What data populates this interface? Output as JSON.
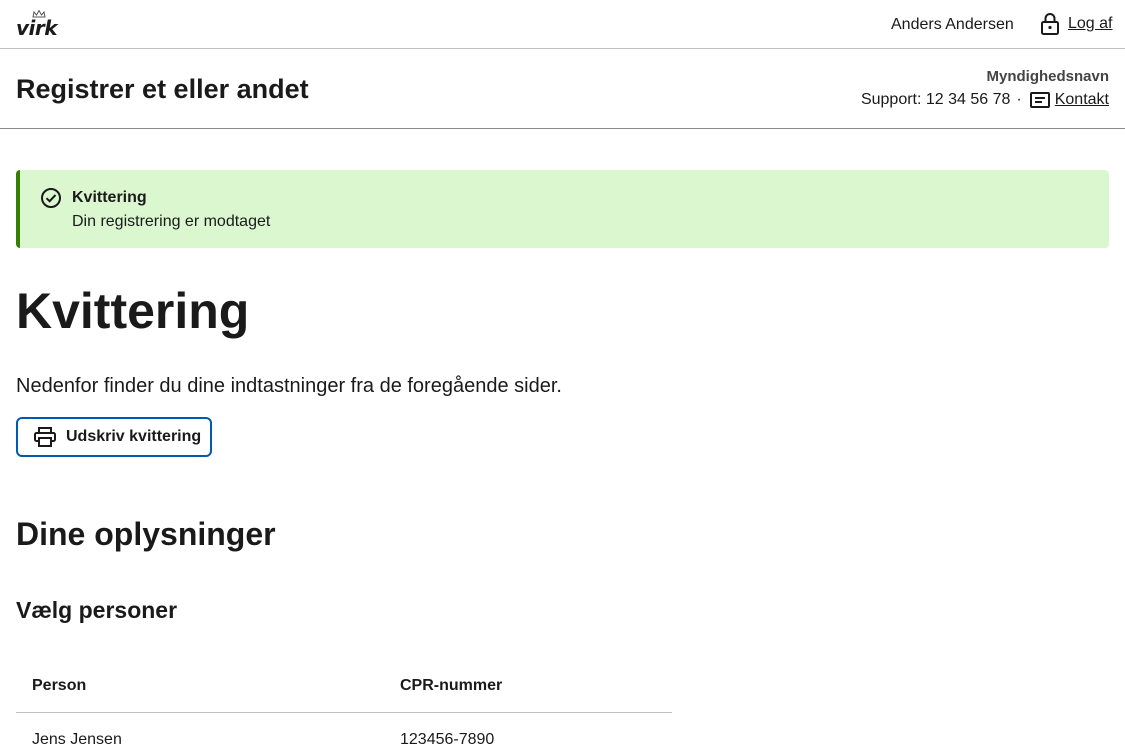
{
  "header": {
    "logo_text": "virk",
    "user_name": "Anders Andersen",
    "logout_label": "Log af"
  },
  "subheader": {
    "title": "Registrer et eller andet",
    "authority": "Myndighedsnavn",
    "support": "Support: 12 34 56 78",
    "separator": "·",
    "contact_label": "Kontakt"
  },
  "alert": {
    "title": "Kvittering",
    "text": "Din registrering er modtaget",
    "color": "#358000",
    "background": "#daf7d0"
  },
  "main": {
    "heading": "Kvittering",
    "intro": "Nedenfor finder du dine indtastninger fra de foregående sider.",
    "print_label": "Udskriv kvittering",
    "section_heading": "Dine oplysninger",
    "subsection_heading": "Vælg personer",
    "table": {
      "headers": [
        "Person",
        "CPR-nummer"
      ],
      "rows": [
        [
          "Jens Jensen",
          "123456-7890"
        ]
      ]
    }
  },
  "colors": {
    "accent": "#0059b3",
    "text": "#1a1a1a"
  },
  "icons": [
    "crown-icon",
    "lock-icon",
    "contact-icon",
    "check-circle-icon",
    "printer-icon"
  ]
}
